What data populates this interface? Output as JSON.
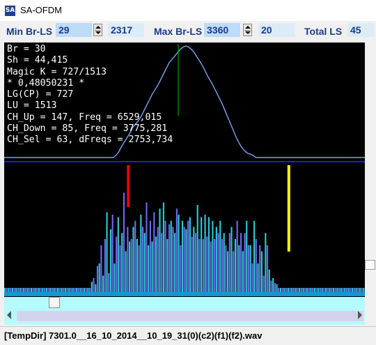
{
  "window": {
    "title": "SA-OFDM",
    "icon": "sa-app-icon"
  },
  "toolbar": {
    "min_label": "Min Br-LS",
    "min_value": "29",
    "min_count": "2317",
    "max_label": "Max Br-LS",
    "max_value": "3360",
    "max_count": "20",
    "total_label": "Total LS",
    "total_value": "45"
  },
  "info_lines": [
    "Br = 30",
    "Sh = 44,415",
    "Magic K = 727/1513",
    "* 0,48050231 *",
    "LG(CP) = 727",
    "LU = 1513",
    "CH_Up = 147, Freq = 6529,015",
    "CH_Down = 85, Freq = 3775,281",
    "CH_Sel = 63, dFreqs = 2753,734"
  ],
  "colors": {
    "background": "#000000",
    "curve": "#7da2f2",
    "marker_green": "#00c000",
    "divider": "#1e22c8",
    "bar_cyan": "#28c8d6",
    "bar_blue": "#6a6ae8",
    "bar_red": "#ff0000",
    "bar_yellow": "#ffff00",
    "baseline": "#1496d2"
  },
  "spectrum_bars": [
    0,
    0,
    0,
    0,
    0,
    0,
    0,
    0,
    0,
    0,
    0,
    0,
    0,
    0,
    0,
    0,
    0,
    0,
    0,
    0,
    0,
    0,
    0,
    0,
    0,
    0,
    0,
    0,
    0,
    0,
    0,
    0,
    0,
    0,
    0,
    0,
    0,
    0,
    0,
    0,
    0,
    0,
    0,
    0,
    0,
    0,
    0.05,
    0.08,
    0.03,
    0.18,
    0.2,
    0.35,
    0.1,
    0.4,
    0.62,
    0.12,
    0.48,
    0.6,
    0.2,
    0.42,
    0.58,
    0.35,
    0.45,
    0.78,
    0.3,
    0.5,
    0.38,
    0.4,
    0.5,
    0.55,
    0.4,
    0.35,
    0.6,
    0.5,
    0.45,
    0.7,
    0.35,
    0.55,
    0.38,
    0.62,
    0.42,
    0.5,
    0.65,
    0.45,
    0.7,
    0.55,
    0.4,
    0.52,
    0.55,
    0.5,
    0.45,
    0.65,
    0.6,
    0.35,
    0.55,
    0.5,
    0.48,
    0.55,
    0.58,
    0.42,
    0.5,
    0.45,
    0.68,
    0.4,
    0.58,
    0.4,
    0.6,
    0.42,
    0.58,
    0.38,
    0.55,
    0.4,
    0.5,
    0.45,
    0.55,
    0.4,
    0.45,
    0.35,
    0.3,
    0.45,
    0.5,
    0.3,
    0.4,
    0.55,
    0.35,
    0.45,
    0.3,
    0.45,
    0.55,
    0.35,
    0.35,
    0.2,
    0.55,
    0.4,
    0.2,
    0.35,
    0.3,
    0.1,
    0.45,
    0.35,
    0.15,
    0.06,
    0.08,
    0.04,
    0.03,
    0,
    0,
    0,
    0,
    0,
    0,
    0,
    0,
    0,
    0,
    0,
    0,
    0,
    0,
    0,
    0,
    0,
    0,
    0,
    0,
    0,
    0,
    0,
    0,
    0,
    0,
    0,
    0,
    0,
    0,
    0,
    0,
    0,
    0,
    0,
    0,
    0,
    0,
    0,
    0,
    0,
    0,
    0,
    0,
    0,
    0
  ],
  "envelope_points": [
    0,
    0,
    0,
    0,
    0,
    0,
    0,
    0,
    0,
    0,
    0,
    0,
    0,
    0,
    0,
    0,
    0,
    0,
    0,
    0,
    0,
    0,
    0,
    0,
    0,
    0,
    0,
    0,
    0,
    0,
    0,
    0,
    0,
    0,
    0,
    0,
    0,
    0,
    0,
    0,
    0.02,
    0.05,
    0.1,
    0.14,
    0.18,
    0.22,
    0.27,
    0.3,
    0.33,
    0.37,
    0.42,
    0.47,
    0.52,
    0.57,
    0.61,
    0.65,
    0.7,
    0.75,
    0.8,
    0.85,
    0.88,
    0.91,
    0.94,
    0.97,
    0.99,
    1.0,
    0.99,
    0.97,
    0.94,
    0.9,
    0.86,
    0.82,
    0.77,
    0.72,
    0.68,
    0.63,
    0.58,
    0.53,
    0.48,
    0.42,
    0.36,
    0.3,
    0.24,
    0.18,
    0.13,
    0.09,
    0.06,
    0.04,
    0.03,
    0.02,
    0,
    0,
    0,
    0,
    0,
    0,
    0,
    0,
    0,
    0,
    0,
    0,
    0,
    0,
    0,
    0,
    0,
    0,
    0,
    0,
    0,
    0,
    0,
    0,
    0,
    0,
    0,
    0,
    0,
    0,
    0,
    0,
    0,
    0,
    0,
    0,
    0,
    0,
    0,
    0
  ],
  "scrollbar": {
    "horizontal_position": 0.12,
    "vertical_position": 0.87
  },
  "status": {
    "path": "[TempDir] 7301.0__16_10_2014__10_19_31(0)(c2)(f1)(f2).wav"
  }
}
